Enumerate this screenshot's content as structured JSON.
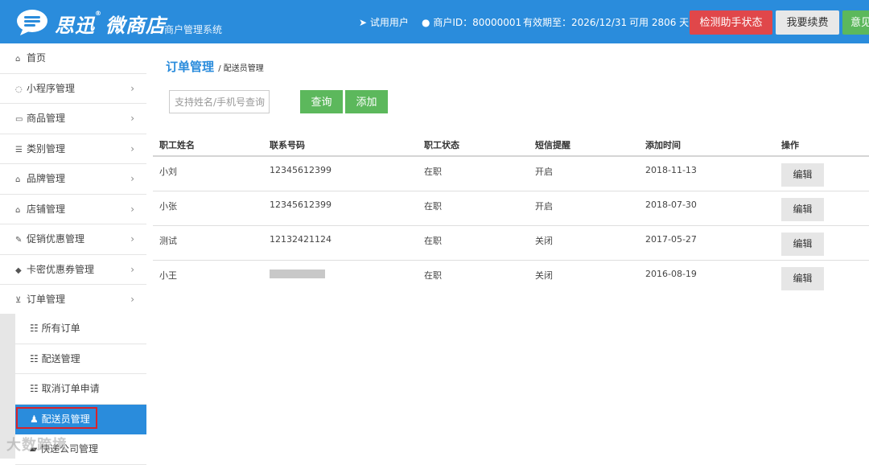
{
  "header": {
    "brand_name": "思迅",
    "brand_product": "微商店",
    "brand_subtitle": "商户管理系统",
    "trial_user": "试用用户",
    "merchant_id": "商户ID：80000001",
    "valid_until": "有效期至：2026/12/31",
    "days_left": "可用 2806 天",
    "btn_check": "检测助手状态",
    "btn_renew": "我要续费",
    "btn_feedback": "意见"
  },
  "sidebar": {
    "items": [
      {
        "label": "首页",
        "icon": "home-icon"
      },
      {
        "label": "小程序管理",
        "icon": "chat-icon"
      },
      {
        "label": "商品管理",
        "icon": "card-icon"
      },
      {
        "label": "类别管理",
        "icon": "list-icon"
      },
      {
        "label": "品牌管理",
        "icon": "bank-icon"
      },
      {
        "label": "店铺管理",
        "icon": "bank-icon"
      },
      {
        "label": "促销优惠管理",
        "icon": "pen-icon"
      },
      {
        "label": "卡密优惠券管理",
        "icon": "tag-icon"
      },
      {
        "label": "订单管理",
        "icon": "cart-icon"
      }
    ],
    "sub_items": [
      {
        "label": "所有订单"
      },
      {
        "label": "配送管理"
      },
      {
        "label": "取消订单申请"
      },
      {
        "label": "配送员管理"
      },
      {
        "label": "快递公司管理"
      }
    ]
  },
  "watermark": "大数跨境",
  "page": {
    "title": "订单管理",
    "crumb_sub": "/ 配送员管理",
    "search_placeholder": "支持姓名/手机号查询",
    "btn_query": "查询",
    "btn_add": "添加"
  },
  "table": {
    "columns": [
      "职工姓名",
      "联系号码",
      "职工状态",
      "短信提醒",
      "添加时间",
      "操作"
    ],
    "edit_label": "编辑",
    "rows": [
      {
        "name": "小刘",
        "phone": "12345612399",
        "status": "在职",
        "sms": "开启",
        "added": "2018-11-13"
      },
      {
        "name": "小张",
        "phone": "12345612399",
        "status": "在职",
        "sms": "开启",
        "added": "2018-07-30"
      },
      {
        "name": "测试",
        "phone": "12132421124",
        "status": "在职",
        "sms": "关闭",
        "added": "2017-05-27"
      },
      {
        "name": "小王",
        "phone": "",
        "status": "在职",
        "sms": "关闭",
        "added": "2016-08-19"
      }
    ]
  },
  "colors": {
    "primary": "#2a8cdc",
    "danger": "#e0474a",
    "success": "#5cb85c",
    "highlight_frame": "#d8232a"
  }
}
